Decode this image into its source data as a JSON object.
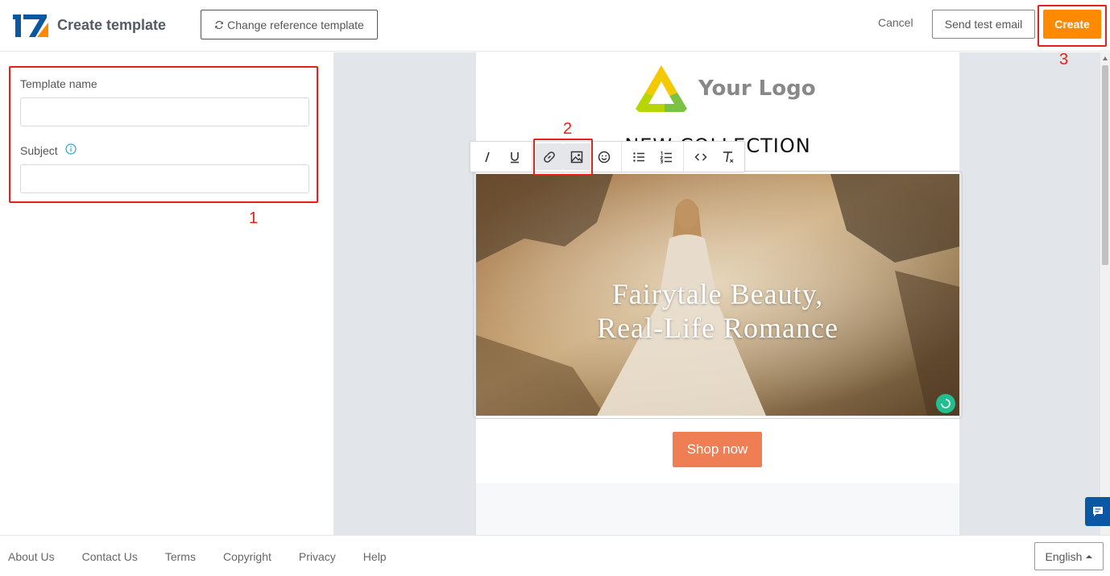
{
  "header": {
    "title": "Create template",
    "change_reference_label": "Change reference template",
    "cancel_label": "Cancel",
    "send_test_label": "Send test email",
    "create_label": "Create"
  },
  "form": {
    "template_name_label": "Template name",
    "template_name_value": "",
    "subject_label": "Subject",
    "subject_value": ""
  },
  "email": {
    "logo_text": "Your Logo",
    "headline": "NEW COLLECTION",
    "hero_line1": "Fairytale Beauty,",
    "hero_line2": "Real-Life Romance",
    "button_label": "Shop now"
  },
  "toolbar": {
    "buttons": [
      "italic-icon",
      "underline-icon",
      "link-icon",
      "image-icon",
      "emoji-icon",
      "bullet-list-icon",
      "numbered-list-icon",
      "code-icon",
      "clear-format-icon"
    ],
    "active": [
      "link-icon",
      "image-icon"
    ]
  },
  "annotations": [
    "1",
    "2",
    "3"
  ],
  "footer": {
    "links": [
      "About Us",
      "Contact Us",
      "Terms",
      "Copyright",
      "Privacy",
      "Help"
    ],
    "language": "English"
  },
  "colors": {
    "accent": "#ff8a00",
    "shop_button": "#f07e55",
    "annotation": "#e8201a",
    "brand_blue": "#0b57a4"
  }
}
